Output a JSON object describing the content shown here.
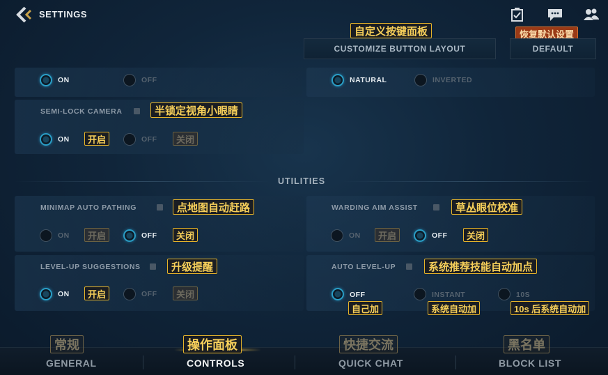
{
  "header": {
    "title": "SETTINGS",
    "icons": [
      "back-chevron-icon",
      "checklist-icon",
      "chat-icon",
      "friends-icon"
    ]
  },
  "top_buttons": {
    "customize": {
      "label": "CUSTOMIZE BUTTON LAYOUT",
      "annotation": "自定义按键面板"
    },
    "default": {
      "label": "DEFAULT",
      "annotation": "恢复默认设置"
    }
  },
  "camera": {
    "row1": {
      "on": "ON",
      "off": "OFF"
    },
    "natural": "NATURAL",
    "inverted": "INVERTED",
    "semi_lock": {
      "label": "SEMI-LOCK CAMERA",
      "annotation": "半锁定视角小眼睛",
      "on": "ON",
      "off": "OFF",
      "on_annotation": "开启",
      "off_annotation": "关闭"
    }
  },
  "utilities": {
    "title": "UTILITIES",
    "minimap": {
      "label": "MINIMAP AUTO PATHING",
      "annotation": "点地图自动赶路",
      "on": "ON",
      "off": "OFF",
      "on_annotation": "开启",
      "off_annotation": "关闭"
    },
    "warding": {
      "label": "WARDING AIM ASSIST",
      "annotation": "草丛眼位校准",
      "on": "ON",
      "off": "OFF",
      "on_annotation": "开启",
      "off_annotation": "关闭"
    },
    "levelup_suggest": {
      "label": "LEVEL-UP SUGGESTIONS",
      "annotation": "升级提醒",
      "on": "ON",
      "off": "OFF",
      "on_annotation": "开启",
      "off_annotation": "关闭"
    },
    "auto_levelup": {
      "label": "AUTO LEVEL-UP",
      "annotation": "系统推荐技能自动加点",
      "options": [
        {
          "label": "OFF",
          "annotation": "自己加"
        },
        {
          "label": "INSTANT",
          "annotation": "系统自动加"
        },
        {
          "label": "10S",
          "annotation": "10s 后系统自动加"
        }
      ]
    }
  },
  "nav": {
    "tabs": [
      {
        "label": "GENERAL",
        "annotation": "常规"
      },
      {
        "label": "CONTROLS",
        "annotation": "操作面板"
      },
      {
        "label": "QUICK CHAT",
        "annotation": "快捷交流"
      },
      {
        "label": "BLOCK LIST",
        "annotation": "黑名单"
      }
    ],
    "active": "CONTROLS"
  }
}
